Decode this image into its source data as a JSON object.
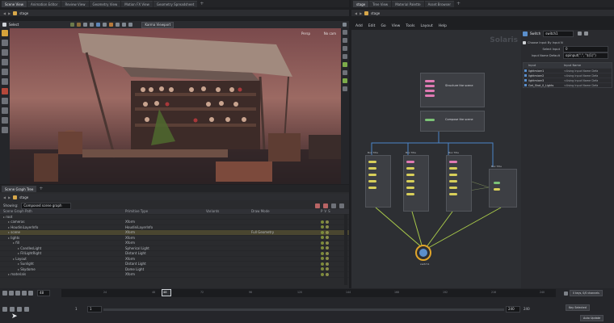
{
  "left_tabs": [
    "Scene View",
    "Animation Editor",
    "Review View",
    "Geometry View",
    "Motion FX View",
    "Geometry Spreadsheet"
  ],
  "right_tabs": [
    "stage",
    "Tree View",
    "Material Palette",
    "Asset Browser"
  ],
  "left_path": "stage",
  "right_path": "stage",
  "viewport": {
    "tool_label": "Select",
    "camera_chip": "Karma Viewport",
    "persp_label": "Persp",
    "cam_label": "No cam"
  },
  "scene_graph": {
    "tab_label": "Scene Graph Tree",
    "path": "stage",
    "filter_label": "Showing:",
    "filter_value": "Composed scene graph",
    "columns": [
      "Scene Graph Path",
      "Primitive Type",
      "Variants",
      "Draw Mode",
      "P",
      "V",
      "S"
    ],
    "rows": [
      {
        "indent": 0,
        "name": "root",
        "type": "",
        "draw": ""
      },
      {
        "indent": 1,
        "name": "cameras",
        "type": "Xform",
        "draw": ""
      },
      {
        "indent": 1,
        "name": "HoudiniLayerInfo",
        "type": "HoudiniLayerInfo",
        "draw": ""
      },
      {
        "indent": 1,
        "name": "scene",
        "type": "Xform",
        "draw": "Full Geometry",
        "highlight": true
      },
      {
        "indent": 1,
        "name": "lights",
        "type": "Xform",
        "draw": ""
      },
      {
        "indent": 2,
        "name": "fill",
        "type": "Xform",
        "draw": ""
      },
      {
        "indent": 3,
        "name": "CandlesLight",
        "type": "Spherical Light",
        "draw": ""
      },
      {
        "indent": 3,
        "name": "FillLightRight",
        "type": "Distant Light",
        "draw": ""
      },
      {
        "indent": 2,
        "name": "Layout",
        "type": "Xform",
        "draw": ""
      },
      {
        "indent": 3,
        "name": "Sunlight",
        "type": "Distant Light",
        "draw": ""
      },
      {
        "indent": 3,
        "name": "Skydome",
        "type": "Dome Light",
        "draw": ""
      },
      {
        "indent": 1,
        "name": "materials",
        "type": "Xform",
        "draw": ""
      }
    ]
  },
  "menu": [
    "Add",
    "Edit",
    "Go",
    "View",
    "Tools",
    "Layout",
    "Help"
  ],
  "network": {
    "context_label": "Solaris",
    "box_labels": [
      "Box Title",
      "Box Title",
      "Box Title",
      "Box Title"
    ],
    "sticky_1": "Structure the scene",
    "sticky_2": "Compose the scene",
    "node_name": "switch1"
  },
  "params": {
    "node_type": "Switch",
    "node_name": "switch1",
    "choose_input": "Choose Input By Input N",
    "select_input_label": "Select Input",
    "select_input_value": "0",
    "input_name_label": "Input Name Default",
    "input_name_value": "opinput(\".\", \"$(1)\")",
    "table_headers": [
      "Input",
      "Input Name"
    ],
    "table_rows": [
      {
        "input": "lightmixer1",
        "name": "<Using Input Name Defa"
      },
      {
        "input": "lightmixer2",
        "name": "<Using Input Name Defa"
      },
      {
        "input": "lightmixer3",
        "name": "<Using Input Name Defa"
      },
      {
        "input": "Get_Shot_0_Lights",
        "name": "<Using Input Name Defa"
      }
    ]
  },
  "timeline": {
    "current_frame": "48",
    "frame_marker": "48",
    "start": "1",
    "start2": "1",
    "end": "240",
    "end2": "240",
    "ticks": [
      "24",
      "48",
      "72",
      "96",
      "120",
      "144",
      "168",
      "192",
      "216",
      "240"
    ],
    "keys_label": "0 keys, 0/0 channels",
    "key_all_label": "Key Selected",
    "auto_update_label": "Auto Update"
  },
  "colors": {
    "accent": "#e0a52a",
    "node_yellow": "#d8cf5a",
    "node_pink": "#e07ab3",
    "node_green": "#7cc276",
    "wire_blue": "#4b84c8",
    "wire_green": "#a8c94a"
  }
}
